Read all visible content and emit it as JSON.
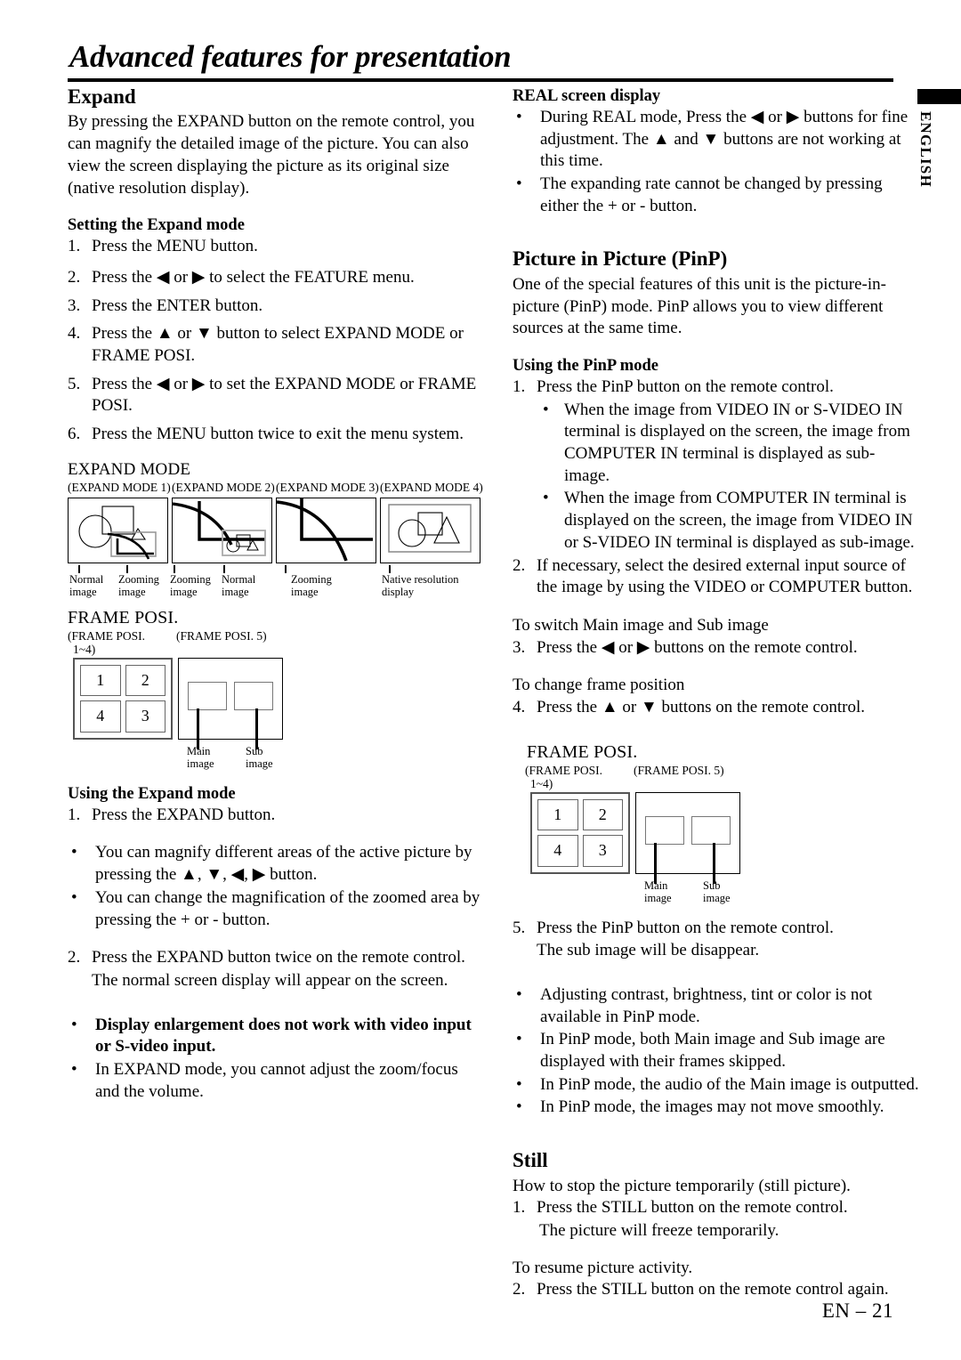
{
  "page": {
    "title": "Advanced features for presentation",
    "language_tab": "ENGLISH",
    "footer": "EN – 21"
  },
  "left_column": {
    "expand": {
      "heading": "Expand",
      "intro": "By pressing the EXPAND button on the remote control, you can magnify the detailed image of the picture. You can also view the screen displaying the picture as its original size (native resolution display).",
      "setting_heading": "Setting the Expand mode",
      "setting_steps": [
        {
          "num": "1.",
          "text": "Press the MENU button."
        },
        {
          "num": "2.",
          "text": "Press the ◀ or ▶ to select the FEATURE menu."
        },
        {
          "num": "3.",
          "text": "Press the ENTER button."
        },
        {
          "num": "4.",
          "text": "Press the ▲ or ▼ button to select EXPAND MODE or FRAME POSI."
        },
        {
          "num": "5.",
          "text": "Press the ◀ or ▶ to set the EXPAND MODE or FRAME POSI."
        },
        {
          "num": "6.",
          "text": "Press the MENU button twice to exit the menu system."
        }
      ],
      "using_heading": "Using the Expand mode",
      "using_steps": [
        {
          "num": "1.",
          "text": "Press the EXPAND button."
        }
      ],
      "using_bullets": [
        {
          "marker": "•",
          "text": "You can magnify different areas of the active picture by pressing the ▲, ▼, ◀, ▶ button."
        },
        {
          "marker": "•",
          "text": "You can change the magnification of the zoomed area by pressing the + or - button."
        }
      ],
      "step2": {
        "num": "2.",
        "text": "Press the EXPAND button twice on the remote control."
      },
      "step2_note": "The normal screen display will appear on the screen.",
      "notes": [
        {
          "marker": "•",
          "text": "Display enlargement does not work with video input or S-video input.",
          "bold": true
        },
        {
          "marker": "•",
          "text": "In EXPAND mode, you cannot adjust the zoom/focus and the volume.",
          "bold": false
        }
      ]
    },
    "expand_mode_figure": {
      "title": "EXPAND MODE",
      "modes": [
        {
          "header": "(EXPAND MODE 1)",
          "labels": [
            "Normal image",
            "Zooming image"
          ]
        },
        {
          "header": "(EXPAND MODE 2)",
          "labels": [
            "Zooming image",
            "Normal image"
          ]
        },
        {
          "header": "(EXPAND MODE 3)",
          "labels": [
            "Zooming image"
          ]
        },
        {
          "header": "(EXPAND MODE 4)",
          "labels": [
            "Native resolution display"
          ]
        }
      ],
      "mode1_label_left": "Normal",
      "mode1_label_left2": "image",
      "mode1_label_right": "Zooming",
      "mode1_label_right2": "image",
      "mode2_label_left": "Zooming",
      "mode2_label_left2": "image",
      "mode2_label_right": "Normal",
      "mode2_label_right2": "image",
      "mode3_label": "Zooming",
      "mode3_label2": "image",
      "mode4_label": "Native resolution",
      "mode4_label2": "display"
    },
    "frame_posi_figure": {
      "title": "FRAME POSI.",
      "header_left_line1": "(FRAME POSI.",
      "header_left_line2": "1~4)",
      "header_right": "(FRAME POSI. 5)",
      "grid_cells": [
        "1",
        "2",
        "4",
        "3"
      ],
      "main_label_line1": "Main",
      "main_label_line2": "image",
      "sub_label_line1": "Sub",
      "sub_label_line2": "image"
    }
  },
  "right_column": {
    "real_screen": {
      "heading": "REAL screen display",
      "bullets": [
        {
          "marker": "•",
          "text": "During REAL mode, Press the ◀ or ▶ buttons for fine adjustment. The ▲ and ▼ buttons are not working at this time."
        },
        {
          "marker": "•",
          "text": "The expanding rate cannot be changed by pressing either the + or - button."
        }
      ]
    },
    "pinp": {
      "heading": "Picture in Picture (PinP)",
      "intro": "One of the special features of this unit is the picture-in-picture (PinP) mode. PinP allows you to view different sources at the same time.",
      "using_heading": "Using the PinP mode",
      "step1": {
        "num": "1.",
        "text": "Press the PinP button on the remote control."
      },
      "step1_bullets": [
        {
          "marker": "•",
          "text": "When the image from VIDEO IN or S-VIDEO IN terminal is displayed on the screen, the image from COMPUTER IN terminal is displayed as sub-image."
        },
        {
          "marker": "•",
          "text": "When the image from COMPUTER IN terminal is displayed on the screen, the image from VIDEO IN or S-VIDEO IN terminal is displayed as sub-image."
        }
      ],
      "step2": {
        "num": "2.",
        "text": "If necessary, select the desired external input source of the image by using the VIDEO or COMPUTER button."
      },
      "switch_note": "To switch Main image and Sub image",
      "step3": {
        "num": "3.",
        "text": "Press the ◀ or ▶ buttons on the remote control."
      },
      "frame_note": "To change frame position",
      "step4": {
        "num": "4.",
        "text": "Press the ▲ or ▼ buttons on the remote control."
      },
      "step5": {
        "num": "5.",
        "text": "Press the PinP button on the remote control."
      },
      "step5_note": "The sub image will be disappear.",
      "notes": [
        {
          "marker": "•",
          "text": "Adjusting contrast, brightness, tint or color is not available in PinP mode."
        },
        {
          "marker": "•",
          "text": "In PinP mode, both Main image and Sub image are displayed with their frames skipped."
        },
        {
          "marker": "•",
          "text": "In PinP mode, the audio of the Main image is outputted."
        },
        {
          "marker": "•",
          "text": "In PinP mode, the images may not move smoothly."
        }
      ]
    },
    "frame_posi_figure": {
      "title": "FRAME POSI.",
      "header_left_line1": "(FRAME POSI.",
      "header_left_line2": "1~4)",
      "header_right": "(FRAME POSI. 5)",
      "grid_cells": [
        "1",
        "2",
        "4",
        "3"
      ],
      "main_label_line1": "Main",
      "main_label_line2": "image",
      "sub_label_line1": "Sub",
      "sub_label_line2": "image"
    },
    "still": {
      "heading": "Still",
      "intro": "How to stop the picture temporarily (still picture).",
      "step1": {
        "num": "1.",
        "text": "Press the STILL button on the remote control."
      },
      "step1_note": "The picture will freeze temporarily.",
      "resume_note": "To resume picture activity.",
      "step2": {
        "num": "2.",
        "text": "Press the STILL button on the remote control again."
      }
    }
  }
}
